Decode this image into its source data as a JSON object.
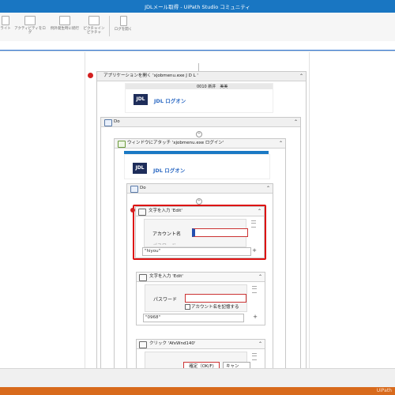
{
  "window": {
    "title": "JDLメール取得 - UiPath Studio コミュニティ"
  },
  "ribbon": {
    "buttons": [
      {
        "label": "ライト"
      },
      {
        "label": "アクティビティをログ"
      },
      {
        "label": "例外発生時に続行"
      },
      {
        "label": "ピクチャインピクチャ"
      },
      {
        "label": "ログを開く"
      }
    ]
  },
  "workflow": {
    "open_app": {
      "title": "アプリケーションを開く 'xjobmenu.exe  J D L '",
      "toolbar_text": "0010 新井　美美",
      "logo_text": "JDL",
      "app_label": "JDL ログオン"
    },
    "do1": {
      "title": "Do"
    },
    "attach": {
      "title": "ウィンドウにアタッチ 'xjobmenu.exe ログイン'",
      "logo_text": "JDL",
      "app_label": "JDL ログオン"
    },
    "do2": {
      "title": "Do"
    },
    "type1": {
      "title": "文字を入力 'Edit'",
      "field_label": "アカウント名",
      "cut_label": "パスワード",
      "value": "\"hiyou\""
    },
    "type2": {
      "title": "文字を入力 'Edit'",
      "field_label": "パスワード",
      "checkbox_label": "アカウント名を記憶する",
      "value": "\"0968\""
    },
    "click": {
      "title": "クリック 'AfxWnd140'",
      "ok_label": "確定（OK/F)",
      "cancel_label": "キャン"
    }
  },
  "statusbar": {
    "right_text": "UiPath"
  },
  "colors": {
    "titlebar": "#1976c2",
    "accent": "#d11",
    "statusbar": "#d86a1c"
  }
}
